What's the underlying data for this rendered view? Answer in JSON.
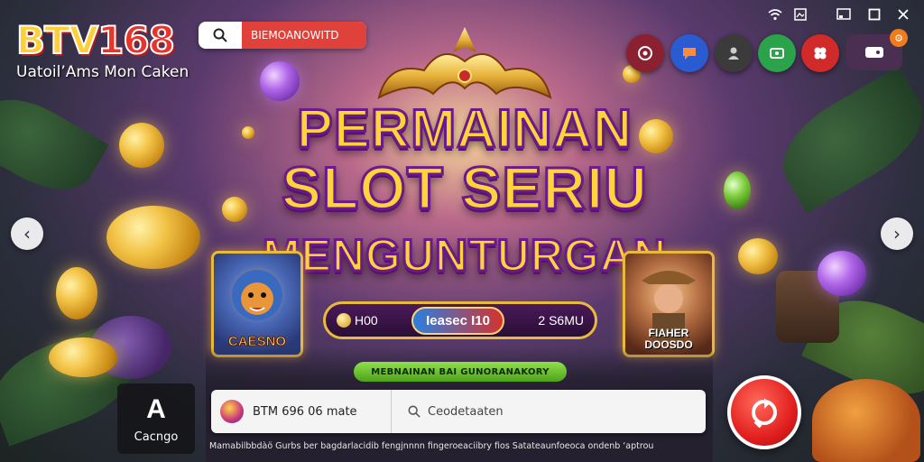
{
  "brand": {
    "logo_prefix": "BTV",
    "logo_number": "168",
    "tagline": "Uatoil’Ams Mon Caken"
  },
  "top_search": {
    "text": "BIEMOANOWITD"
  },
  "window_controls": {
    "wifi": "wifi-icon",
    "gallery": "image-icon",
    "cast": "cast-icon",
    "maximize": "maximize-icon",
    "close": "close-icon"
  },
  "app_icons": [
    {
      "name": "target-icon",
      "color": "#8a2030"
    },
    {
      "name": "chat-icon",
      "color": "#2a5bd1"
    },
    {
      "name": "person-icon",
      "color": "#3b3b3b"
    },
    {
      "name": "ticket-icon",
      "color": "#2aa34a"
    },
    {
      "name": "clover-icon",
      "color": "#d12a2a"
    }
  ],
  "profile": {
    "badge": "⚙"
  },
  "nav": {
    "prev": "‹",
    "next": "›"
  },
  "hero": {
    "line1": "PERMAINAN",
    "line2": "SLOT SERIU",
    "line3": "MENGUNTURGAN"
  },
  "cards": {
    "left_label": "CAESNO",
    "right_label_line1": "FIAHER",
    "right_label_line2": "DOOSDO"
  },
  "stats": {
    "left": "H00",
    "middle": "Ieasec I10",
    "right": "2 S6MU"
  },
  "promo_pill": "MEBNAINAN BAI GUNORANAKORY",
  "search_panel": {
    "brand_label": "BTM 696 06 mate",
    "query_placeholder": "Ceodetaaten"
  },
  "footer_text": "Mamabilbbdàö Gurbs ber bagdarlacidib fengjnnnn fingeroeaciibry fios Satateaunfoeoca ondenb ‘aptrou",
  "category": {
    "icon_letter": "A",
    "label": "Cacngo"
  },
  "colors": {
    "accent_gold": "#ffd43a",
    "accent_red": "#e21f1f",
    "accent_green": "#4ea21a"
  }
}
